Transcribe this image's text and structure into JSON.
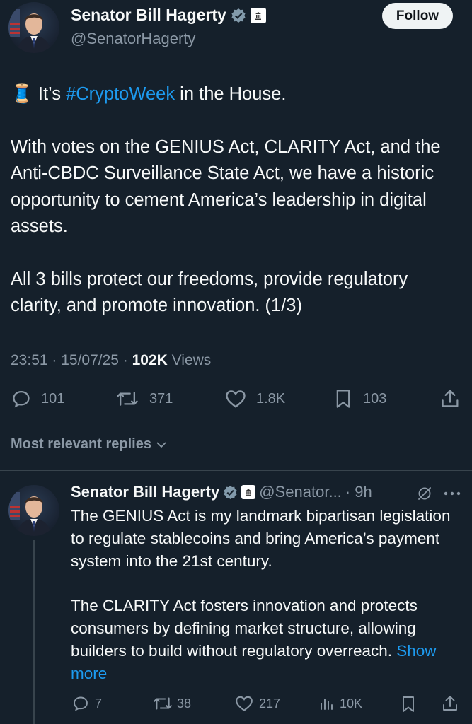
{
  "tweet": {
    "author_name": "Senator Bill Hagerty",
    "handle": "@SenatorHagerty",
    "follow_label": "Follow",
    "emoji": "🧵",
    "text_prefix": "It’s ",
    "hashtag": "#CryptoWeek",
    "text_suffix": " in the House.",
    "paragraph2": "With votes on the GENIUS Act, CLARITY Act, and the Anti-CBDC Surveillance State Act, we have a historic opportunity to cement America’s leadership in digital assets.",
    "paragraph3": "All 3 bills protect our freedoms, provide regulatory clarity, and promote innovation. (1/3)",
    "timestamp": "23:51 · 15/07/25 · ",
    "views_count": "102K",
    "views_label": " Views",
    "actions": {
      "replies": "101",
      "reposts": "371",
      "likes": "1.8K",
      "bookmarks": "103"
    }
  },
  "replies_filter": "Most relevant replies",
  "reply": {
    "author_name": "Senator Bill Hagerty",
    "handle": "@Senator...",
    "time": "· 9h",
    "paragraph1": "The GENIUS Act is my landmark bipartisan legislation to regulate stablecoins and bring America’s payment system into the 21st century.",
    "paragraph2": "The CLARITY Act fosters innovation and protects consumers by defining market structure, allowing builders to build without regulatory overreach.",
    "show_more": "Show more",
    "actions": {
      "replies": "7",
      "reposts": "38",
      "likes": "217",
      "views": "10K"
    }
  },
  "colors": {
    "background": "#15202b",
    "text": "#f7f9f9",
    "muted": "#8b98a5",
    "accent": "#1d9bf0",
    "divider": "#38444d"
  }
}
